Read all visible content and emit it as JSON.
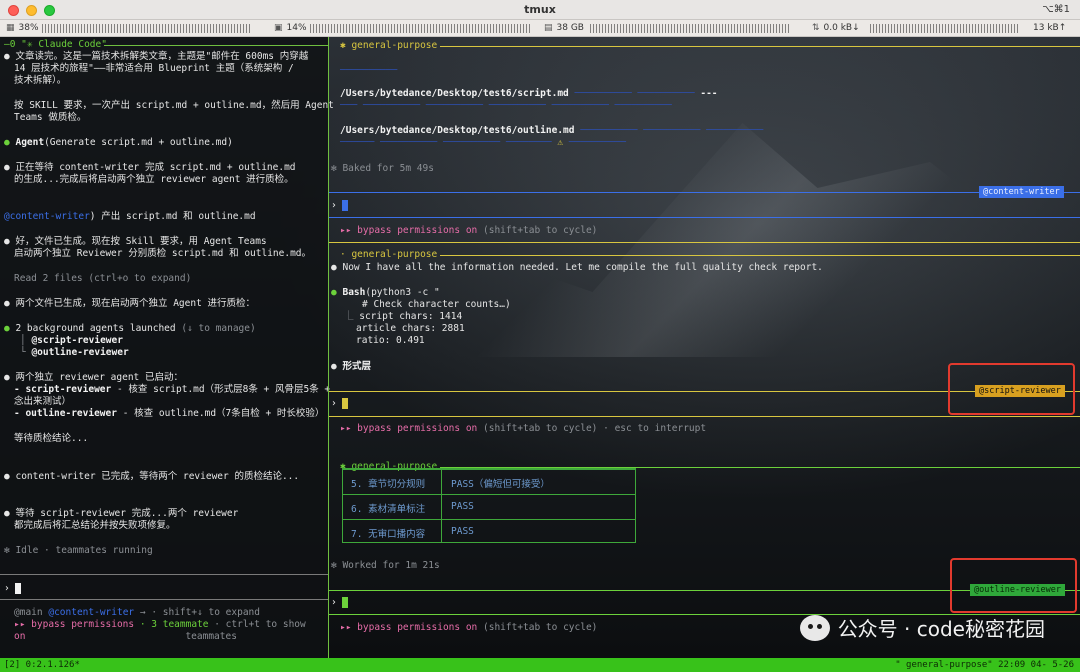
{
  "window": {
    "title": "tmux",
    "shortcut": "⌥⌘1"
  },
  "statusbar": {
    "cpu": "38%",
    "gpu": "14%",
    "memory": "38 GB",
    "net_down": "0.0 kB↓",
    "net_up": "13 kB↑"
  },
  "left": {
    "header": "—0 \"✳ Claude Code\"",
    "lines": [
      "文章读完。这是一篇技术拆解类文章，主题是\"邮件在 600ms 内穿越",
      "14 层技术的旅程\"——非常适合用 Blueprint 主题（系统架构 /",
      "技术拆解）。",
      "按 SKILL 要求，一次产出 script.md + outline.md，然后用 Agent",
      "Teams 做质检。",
      "Agent",
      "(Generate script.md + outline.md)",
      "正在等待 content-writer 完成 script.md + outline.md",
      "的生成...完成后将启动两个独立 reviewer agent 进行质检。",
      "@content-writer",
      "产出 script.md 和 outline.md",
      "好，文件已生成。现在按 Skill 要求，用 Agent Teams",
      "启动两个独立 Reviewer 分别质检 script.md 和 outline.md。",
      "Read 2 files (ctrl+o to expand)",
      "两个文件已生成，现在启动两个独立 Agent 进行质检：",
      "2 background agents launched",
      "(↓ to manage)",
      "@script-reviewer",
      "@outline-reviewer",
      "两个独立 reviewer agent 已启动：",
      "- script-reviewer",
      "- 核查 script.md（形式层8条 + 风骨层5条 +",
      "念出来测试）",
      "- outline-reviewer",
      "- 核查 outline.md（7条自检 + 时长校验）",
      "等待质检结论...",
      "content-writer 已完成，等待两个 reviewer 的质检结论...",
      "等待 script-reviewer 完成...两个 reviewer",
      "都完成后将汇总结论并按失败项修复。",
      "✻ Idle · teammates running",
      "@main",
      "@content-writer",
      "→ · shift+↓ to expand",
      "▸▸ bypass permissions",
      "· 3 teammate",
      "· ctrl+t to show",
      "on",
      "teammates"
    ]
  },
  "right": {
    "header1": "✱ general-purpose",
    "path1": "/Users/bytedance/Desktop/test6/script.md",
    "path1_tail": "---",
    "path2": "/Users/bytedance/Desktop/test6/outline.md",
    "baked": "✻ Baked for 5m 49s",
    "tag1": "@content-writer",
    "bypass": "▸▸ bypass permissions on",
    "bypass_hint": "(shift+tab to cycle)",
    "header2": "· general-purpose",
    "msg": "Now I have all the information needed. Let me compile the full quality check report.",
    "bash": "Bash",
    "bash_arg": "(python3 -c \"",
    "comment": "# Check character counts…)",
    "script_chars": "script chars: 1414",
    "article_chars": "article chars: 2881",
    "ratio": "ratio: 0.491",
    "form_layer": "形式层",
    "tag2": "@script-reviewer",
    "bypass2_hint": "(shift+tab to cycle) · esc to interrupt",
    "header3": "✱ general-purpose",
    "table": [
      [
        "5. 章节切分规则",
        "PASS（偏短但可接受）"
      ],
      [
        "6. 素材清单标注",
        "PASS"
      ],
      [
        "7. 无审口播内容",
        "PASS"
      ]
    ],
    "worked": "✻ Worked for 1m 21s",
    "tag3": "@outline-reviewer",
    "bypass3_hint": "(shift+tab to cycle)"
  },
  "bottom": {
    "left": "[2] 0:2.1.126*",
    "right": "\" general-purpose\" 22:09 04- 5-26"
  },
  "watermark": "公众号 · code秘密花园"
}
